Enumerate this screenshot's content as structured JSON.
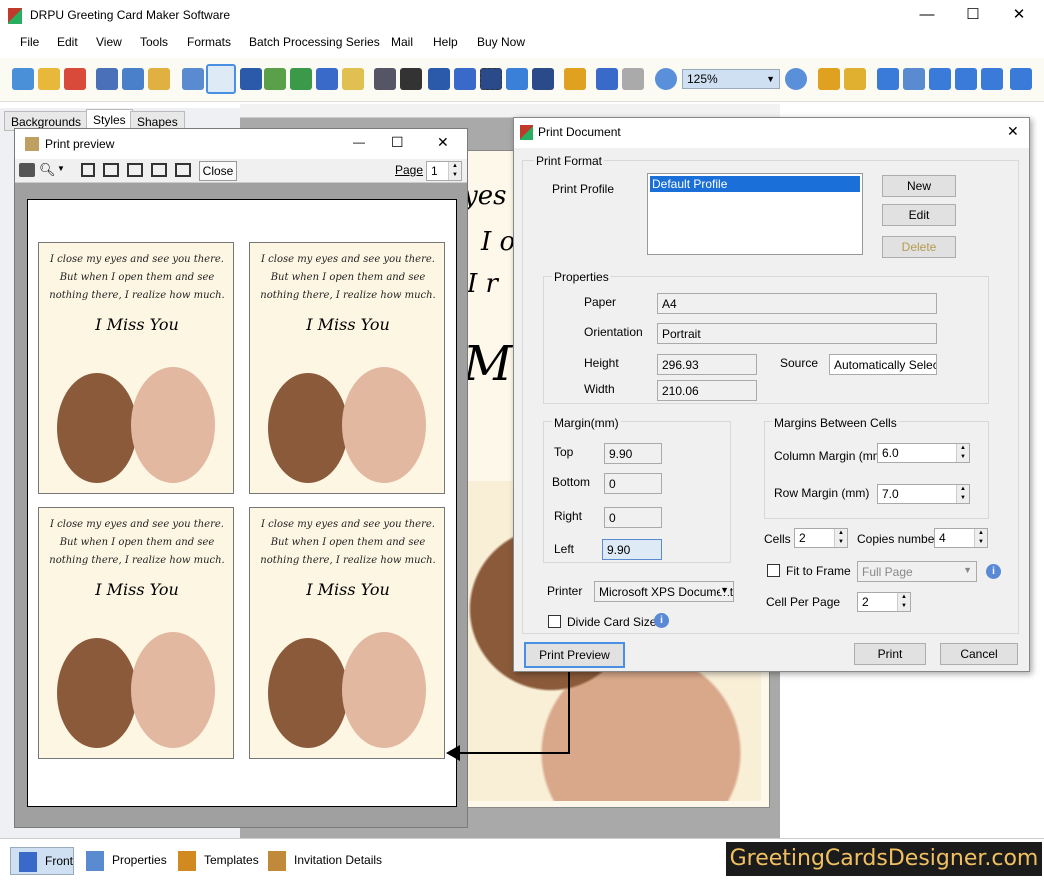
{
  "app": {
    "title": "DRPU Greeting Card Maker Software",
    "brand": "GreetingCardsDesigner.com"
  },
  "menu": [
    "File",
    "Edit",
    "View",
    "Tools",
    "Formats",
    "Batch Processing Series",
    "Mail",
    "Help",
    "Buy Now"
  ],
  "toolbar": {
    "zoom": "125%"
  },
  "left_tabs": [
    "Backgrounds",
    "Styles",
    "Shapes"
  ],
  "bottom_tabs": [
    "Front",
    "Properties",
    "Templates",
    "Invitation Details"
  ],
  "canvas_text": [
    "yes",
    "I op",
    "I r",
    "Mis"
  ],
  "print_preview": {
    "title": "Print preview",
    "close_label": "Close",
    "page_label": "Page",
    "page_value": "1",
    "card_text": "I close my eyes and see you there. But when I open them and see nothing there, I realize how much.",
    "card_heading": "I Miss You"
  },
  "print_document": {
    "title": "Print Document",
    "print_format": "Print Format",
    "print_profile_label": "Print Profile",
    "profiles": [
      "Default Profile"
    ],
    "new_label": "New",
    "edit_label": "Edit",
    "delete_label": "Delete",
    "properties_label": "Properties",
    "paper_label": "Paper",
    "paper_value": "A4",
    "orientation_label": "Orientation",
    "orientation_value": "Portrait",
    "height_label": "Height",
    "height_value": "296.93",
    "width_label": "Width",
    "width_value": "210.06",
    "source_label": "Source",
    "source_value": "Automatically Select",
    "margin_label": "Margin(mm)",
    "top_label": "Top",
    "top_value": "9.90",
    "bottom_label": "Bottom",
    "bottom_value": "0",
    "right_label": "Right",
    "right_value": "0",
    "left_label": "Left",
    "left_value": "9.90",
    "cells_margin_label": "Margins Between Cells",
    "column_margin_label": "Column Margin (mm)",
    "column_margin_value": "6.0",
    "row_margin_label": "Row Margin (mm)",
    "row_margin_value": "7.0",
    "cells_label": "Cells",
    "cells_value": "2",
    "copies_label": "Copies number",
    "copies_value": "4",
    "fit_to_frame_label": "Fit to Frame",
    "fit_value": "Full Page",
    "cell_per_page_label": "Cell Per Page",
    "cell_per_page_value": "2",
    "printer_label": "Printer",
    "printer_value": "Microsoft XPS Document Writer",
    "divide_label": "Divide Card Size",
    "print_preview_label": "Print Preview",
    "print_label": "Print",
    "cancel_label": "Cancel"
  }
}
